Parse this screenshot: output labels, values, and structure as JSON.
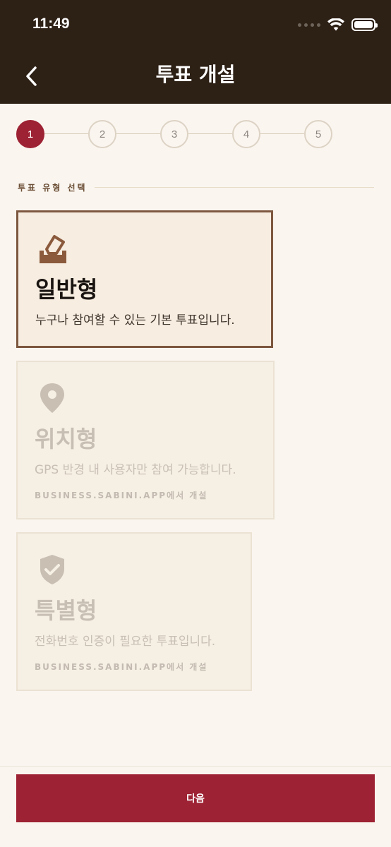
{
  "status_bar": {
    "time": "11:49"
  },
  "nav": {
    "title": "투표 개설"
  },
  "stepper": {
    "steps": [
      "1",
      "2",
      "3",
      "4",
      "5"
    ],
    "current": 1
  },
  "section": {
    "label": "투표 유형 선택"
  },
  "cards": [
    {
      "title": "일반형",
      "description": "누구나 참여할 수 있는 기본 투표입니다.",
      "selected": true
    },
    {
      "title": "위치형",
      "description": "GPS 반경 내 사용자만 참여 가능합니다.",
      "note": "BUSINESS.SABINI.APP에서 개설",
      "selected": false
    },
    {
      "title": "특별형",
      "description": "전화번호 인증이 필요한 투표입니다.",
      "note": "BUSINESS.SABINI.APP에서 개설",
      "selected": false
    }
  ],
  "footer": {
    "next_label": "다음"
  },
  "colors": {
    "header_bg": "#2d2015",
    "accent": "#9d2233",
    "selected_border": "#7d573f",
    "page_bg": "#faf5ef"
  },
  "icons": {
    "card_0": "ballot-box-icon",
    "card_1": "location-pin-icon",
    "card_2": "shield-check-icon"
  }
}
